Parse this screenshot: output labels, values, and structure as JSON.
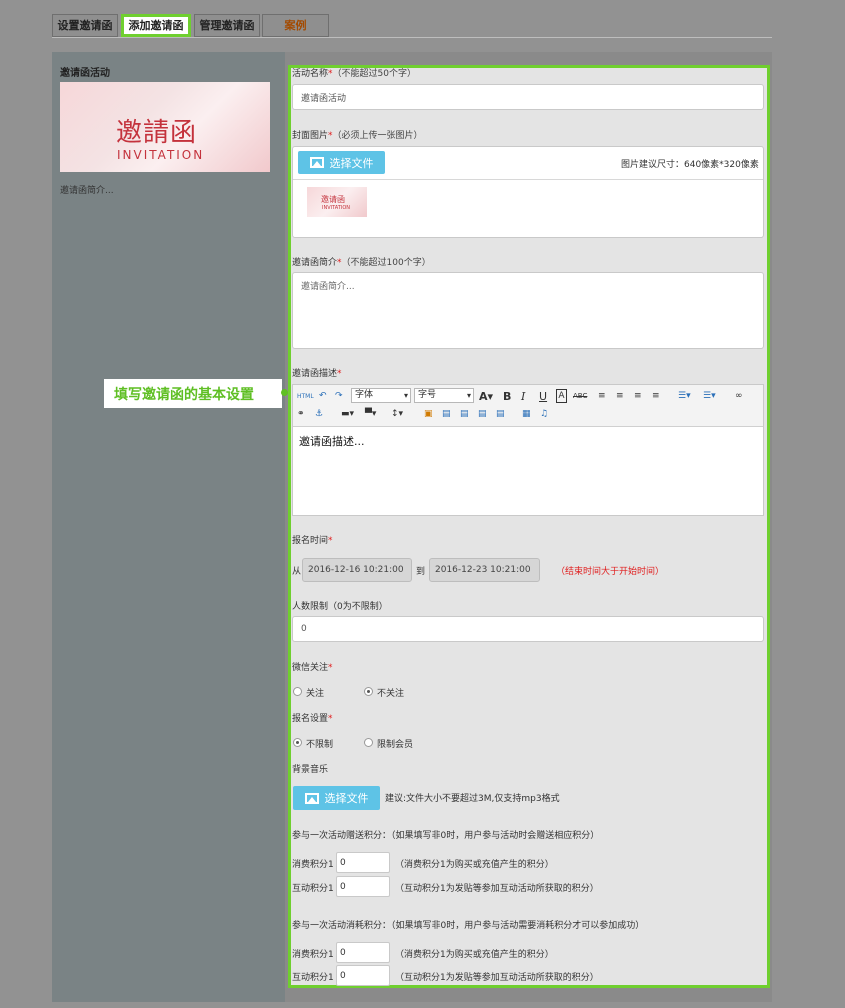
{
  "tabs": [
    {
      "label": "设置邀请函"
    },
    {
      "label": "添加邀请函"
    },
    {
      "label": "管理邀请函"
    },
    {
      "label": "案例"
    }
  ],
  "preview": {
    "title": "邀请函活动",
    "cover_text": "邀請函",
    "cover_subtext": "INVITATION",
    "description": "邀请函简介..."
  },
  "form": {
    "activity_name": {
      "label": "活动名称",
      "hint": "（不能超过50个字）",
      "value": "邀请函活动"
    },
    "cover": {
      "label": "封面图片",
      "hint": "（必须上传一张图片）",
      "button": "选择文件",
      "size_hint": "图片建议尺寸：640像素*320像素",
      "thumb_text": "邀请函",
      "thumb_subtext": "INVITATION"
    },
    "intro": {
      "label": "邀请函简介",
      "hint": "（不能超过100个字）",
      "placeholder": "邀请函简介..."
    },
    "desc": {
      "label": "邀请函描述",
      "font_select": "字体",
      "size_select": "字号",
      "body": "邀请函描述..."
    },
    "signup_time": {
      "label": "报名时间",
      "from": "从",
      "start": "2016-12-16 10:21:00",
      "to": "到",
      "end": "2016-12-23 10:21:00",
      "warning": "（结束时间大于开始时间）"
    },
    "people_limit": {
      "label": "人数限制（0为不限制）",
      "value": "0"
    },
    "wechat_follow": {
      "label": "微信关注",
      "options": [
        "关注",
        "不关注"
      ],
      "selected": "不关注"
    },
    "signup_setting": {
      "label": "报名设置",
      "options": [
        "不限制",
        "限制会员"
      ],
      "selected": "不限制"
    },
    "music": {
      "label": "背景音乐",
      "button": "选择文件",
      "hint": "建议:文件大小不要超过3M,仅支持mp3格式"
    },
    "gift_points": {
      "title": "参与一次活动赠送积分：（如果填写非0时，用户参与活动时会赠送相应积分）",
      "rows": [
        {
          "label": "消费积分1",
          "value": "0",
          "note": "（消费积分1为购买或充值产生的积分）"
        },
        {
          "label": "互动积分1",
          "value": "0",
          "note": "（互动积分1为发贴等参加互动活动所获取的积分）"
        }
      ]
    },
    "cost_points": {
      "title": "参与一次活动消耗积分：（如果填写非0时，用户参与活动需要消耗积分才可以参加成功）",
      "rows": [
        {
          "label": "消费积分1",
          "value": "0",
          "note": "（消费积分1为购买或充值产生的积分）"
        },
        {
          "label": "互动积分1",
          "value": "0",
          "note": "（互动积分1为发贴等参加互动活动所获取的积分）"
        }
      ]
    }
  },
  "callout": "填写邀请函的基本设置",
  "colors": {
    "accent_green": "#6fcf2f",
    "button_blue": "#5ec3e6",
    "required_red": "#e02020"
  }
}
